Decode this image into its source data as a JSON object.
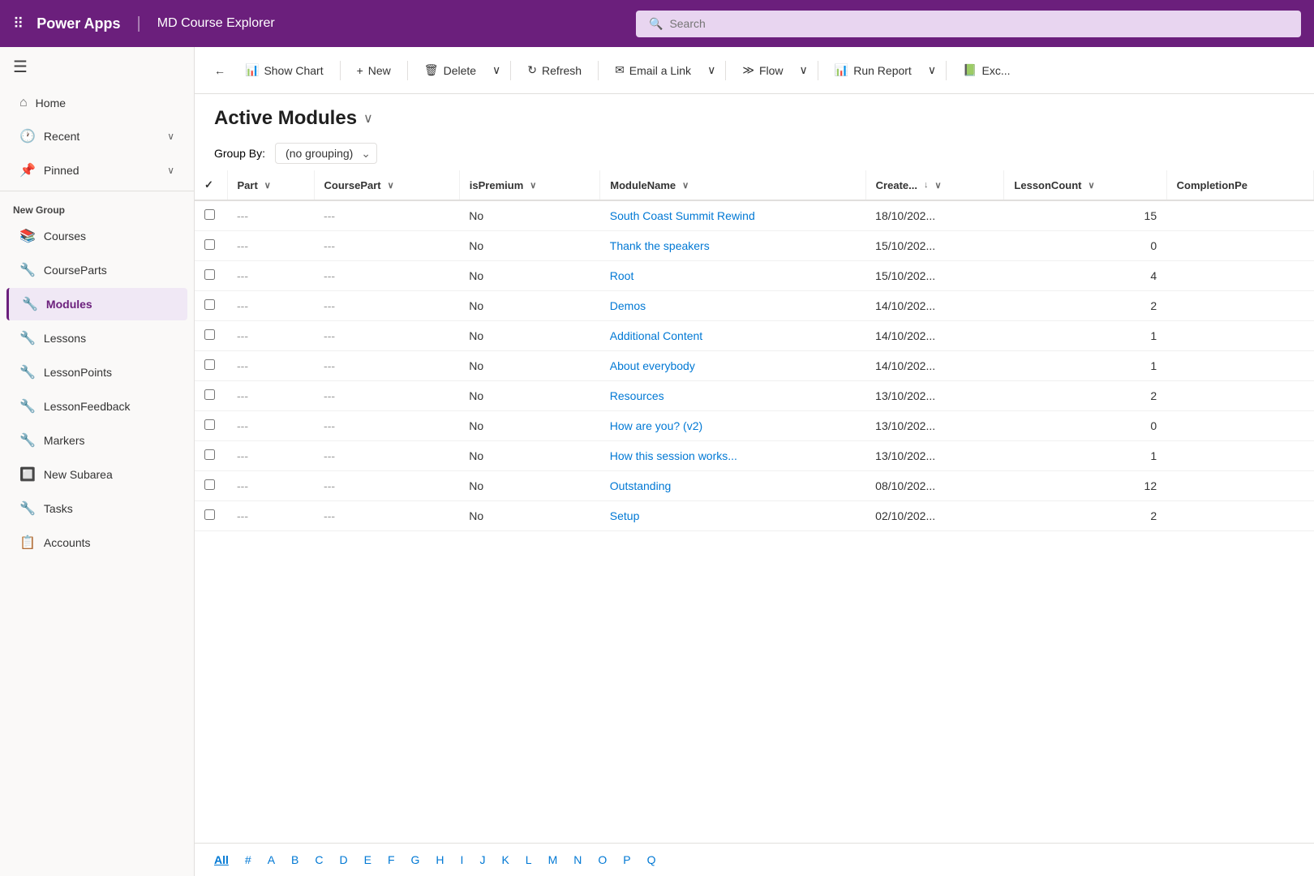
{
  "topnav": {
    "app_name": "Power Apps",
    "divider": "|",
    "page_title": "MD Course Explorer",
    "search_placeholder": "Search"
  },
  "sidebar": {
    "menu_items": [
      {
        "id": "home",
        "label": "Home",
        "icon": "⌂",
        "has_chevron": false
      },
      {
        "id": "recent",
        "label": "Recent",
        "icon": "🕐",
        "has_chevron": true
      },
      {
        "id": "pinned",
        "label": "Pinned",
        "icon": "📌",
        "has_chevron": true
      }
    ],
    "group_label": "New Group",
    "group_items": [
      {
        "id": "courses",
        "label": "Courses",
        "icon": "📚",
        "active": false
      },
      {
        "id": "courseparts",
        "label": "CourseParts",
        "icon": "🔧",
        "active": false
      },
      {
        "id": "modules",
        "label": "Modules",
        "icon": "🔧",
        "active": true
      },
      {
        "id": "lessons",
        "label": "Lessons",
        "icon": "🔧",
        "active": false
      },
      {
        "id": "lessonpoints",
        "label": "LessonPoints",
        "icon": "🔧",
        "active": false
      },
      {
        "id": "lessonfeedback",
        "label": "LessonFeedback",
        "icon": "🔧",
        "active": false
      },
      {
        "id": "markers",
        "label": "Markers",
        "icon": "🔧",
        "active": false
      },
      {
        "id": "newsubarea",
        "label": "New Subarea",
        "icon": "🔲",
        "active": false
      },
      {
        "id": "tasks",
        "label": "Tasks",
        "icon": "🔧",
        "active": false
      },
      {
        "id": "accounts",
        "label": "Accounts",
        "icon": "📋",
        "active": false
      }
    ]
  },
  "toolbar": {
    "back_label": "←",
    "show_chart_label": "Show Chart",
    "new_label": "New",
    "delete_label": "Delete",
    "refresh_label": "Refresh",
    "email_link_label": "Email a Link",
    "flow_label": "Flow",
    "run_report_label": "Run Report",
    "excel_label": "Exc..."
  },
  "page": {
    "title": "Active Modules",
    "group_by_label": "Group By:",
    "group_by_value": "(no grouping)"
  },
  "table": {
    "columns": [
      {
        "id": "check",
        "label": "✓",
        "sortable": false
      },
      {
        "id": "part",
        "label": "Part",
        "sortable": true
      },
      {
        "id": "coursepart",
        "label": "CoursePart",
        "sortable": true
      },
      {
        "id": "ispremium",
        "label": "isPremium",
        "sortable": true
      },
      {
        "id": "modulename",
        "label": "ModuleName",
        "sortable": true
      },
      {
        "id": "created",
        "label": "Create...",
        "sortable": true,
        "sort_dir": "desc"
      },
      {
        "id": "lessoncount",
        "label": "LessonCount",
        "sortable": true
      },
      {
        "id": "completionpe",
        "label": "CompletionPe",
        "sortable": true
      }
    ],
    "rows": [
      {
        "part": "---",
        "coursepart": "---",
        "ispremium": "No",
        "modulename": "South Coast Summit Rewind",
        "created": "18/10/202...",
        "lessoncount": "15",
        "completionpe": ""
      },
      {
        "part": "---",
        "coursepart": "---",
        "ispremium": "No",
        "modulename": "Thank the speakers",
        "created": "15/10/202...",
        "lessoncount": "0",
        "completionpe": ""
      },
      {
        "part": "---",
        "coursepart": "---",
        "ispremium": "No",
        "modulename": "Root",
        "created": "15/10/202...",
        "lessoncount": "4",
        "completionpe": ""
      },
      {
        "part": "---",
        "coursepart": "---",
        "ispremium": "No",
        "modulename": "Demos",
        "created": "14/10/202...",
        "lessoncount": "2",
        "completionpe": ""
      },
      {
        "part": "---",
        "coursepart": "---",
        "ispremium": "No",
        "modulename": "Additional Content",
        "created": "14/10/202...",
        "lessoncount": "1",
        "completionpe": ""
      },
      {
        "part": "---",
        "coursepart": "---",
        "ispremium": "No",
        "modulename": "About everybody",
        "created": "14/10/202...",
        "lessoncount": "1",
        "completionpe": ""
      },
      {
        "part": "---",
        "coursepart": "---",
        "ispremium": "No",
        "modulename": "Resources",
        "created": "13/10/202...",
        "lessoncount": "2",
        "completionpe": ""
      },
      {
        "part": "---",
        "coursepart": "---",
        "ispremium": "No",
        "modulename": "How are you? (v2)",
        "created": "13/10/202...",
        "lessoncount": "0",
        "completionpe": ""
      },
      {
        "part": "---",
        "coursepart": "---",
        "ispremium": "No",
        "modulename": "How this session works...",
        "created": "13/10/202...",
        "lessoncount": "1",
        "completionpe": ""
      },
      {
        "part": "---",
        "coursepart": "---",
        "ispremium": "No",
        "modulename": "Outstanding",
        "created": "08/10/202...",
        "lessoncount": "12",
        "completionpe": ""
      },
      {
        "part": "---",
        "coursepart": "---",
        "ispremium": "No",
        "modulename": "Setup",
        "created": "02/10/202...",
        "lessoncount": "2",
        "completionpe": ""
      }
    ]
  },
  "alpha_bar": {
    "items": [
      "All",
      "#",
      "A",
      "B",
      "C",
      "D",
      "E",
      "F",
      "G",
      "H",
      "I",
      "J",
      "K",
      "L",
      "M",
      "N",
      "O",
      "P",
      "Q"
    ]
  },
  "colors": {
    "header_bg": "#6b1f7c",
    "accent": "#6b1f7c",
    "link": "#0078d4"
  }
}
